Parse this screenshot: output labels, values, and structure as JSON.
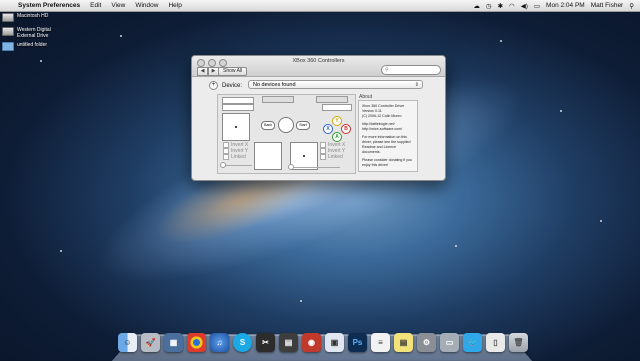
{
  "menubar": {
    "apple_glyph": "",
    "app_name": "System Preferences",
    "items": [
      "Edit",
      "View",
      "Window",
      "Help"
    ],
    "clock": "Mon 2:04 PM",
    "user": "Matt Fisher"
  },
  "desktop_icons": [
    {
      "label": "Macintosh HD",
      "kind": "drive"
    },
    {
      "label": "Western Digital External Drive",
      "kind": "drive"
    },
    {
      "label": "untitled folder",
      "kind": "folder"
    }
  ],
  "window": {
    "title": "XBox 360 Controllers",
    "show_all": "Show All",
    "search_placeholder": "",
    "device_label": "Device:",
    "device_value": "No devices found",
    "back_label": "Back",
    "start_label": "Start",
    "buttons": {
      "y": "Y",
      "x": "X",
      "b": "B",
      "a": "A"
    },
    "invert_x": "Invert X",
    "invert_y": "Invert Y",
    "linked": "Linked",
    "about_title": "About",
    "about_lines": [
      "Xbox 360 Controller Driver",
      "Version 0.11",
      "(C) 2006-12 Colin Munro",
      "http://tattiebogle.net/",
      "http://mice-software.com/",
      "For more information on this driver, please see the supplied Readme and Licence documents.",
      "Please consider donating if you enjoy this driver!"
    ]
  },
  "dock": {
    "apps": [
      "Finder",
      "Launchpad",
      "Mission Control",
      "Chrome",
      "iTunes",
      "Skype",
      "Final Cut Pro",
      "Photo Booth",
      "Preview",
      "Photoshop",
      "TextEdit",
      "Stickies",
      "System Preferences",
      "Screen Capture",
      "Twitter",
      "Documents",
      "Trash"
    ]
  },
  "colors": {
    "button_y": "#d9a400",
    "button_x": "#2a63c9",
    "button_b": "#c92a2a",
    "button_a": "#2f9a2f"
  }
}
